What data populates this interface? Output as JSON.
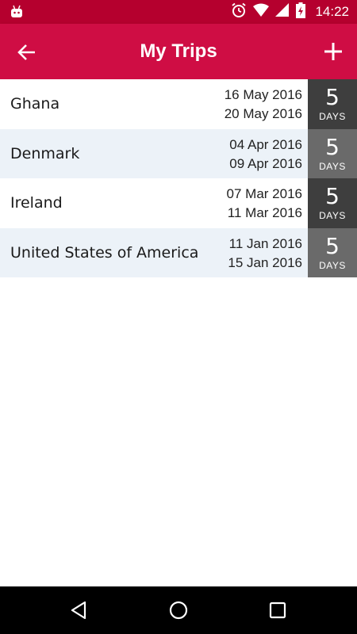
{
  "status_bar": {
    "time": "14:22",
    "icons": [
      "android-icon",
      "alarm-icon",
      "wifi-icon",
      "signal-icon",
      "battery-charging-icon"
    ]
  },
  "app_bar": {
    "title": "My Trips",
    "back_icon": "arrow-back-icon",
    "add_icon": "plus-icon",
    "color": "#cf0d44"
  },
  "trips": [
    {
      "country": "Ghana",
      "start": "16 May 2016",
      "end": "20 May 2016",
      "days": "5",
      "days_label": "DAYS"
    },
    {
      "country": "Denmark",
      "start": "04 Apr 2016",
      "end": "09 Apr 2016",
      "days": "5",
      "days_label": "DAYS"
    },
    {
      "country": "Ireland",
      "start": "07 Mar 2016",
      "end": "11 Mar 2016",
      "days": "5",
      "days_label": "DAYS"
    },
    {
      "country": "United States of America",
      "start": "11 Jan 2016",
      "end": "15 Jan 2016",
      "days": "5",
      "days_label": "DAYS"
    }
  ],
  "nav_bar": {
    "icons": [
      "back-triangle-icon",
      "home-circle-icon",
      "recents-square-icon"
    ]
  }
}
